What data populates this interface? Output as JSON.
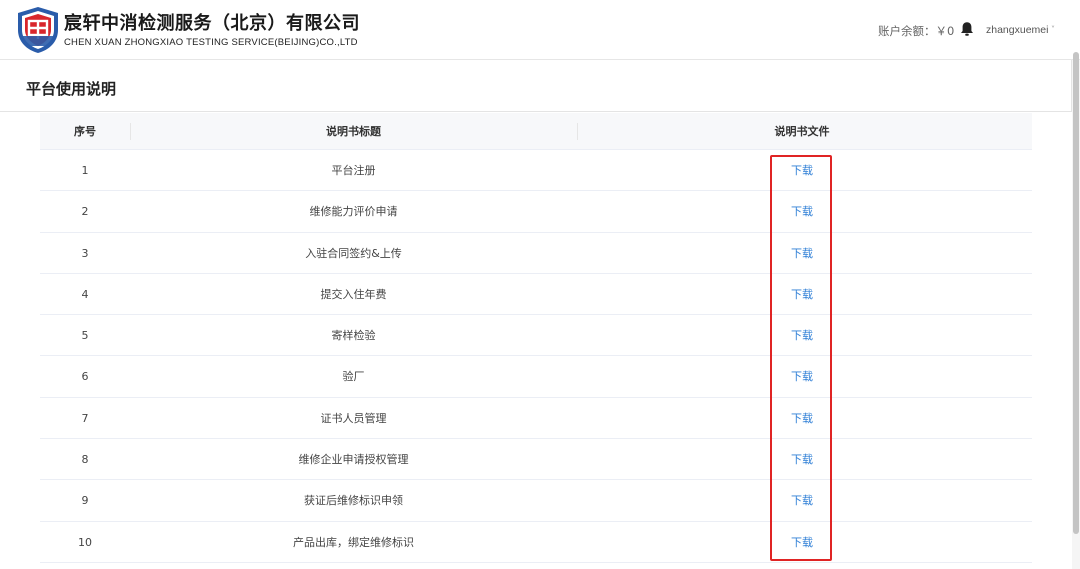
{
  "header": {
    "company_name_cn": "宸轩中消检测服务（北京）有限公司",
    "company_name_en": "CHEN XUAN ZHONGXIAO TESTING SERVICE(BEIJING)CO.,LTD",
    "balance_label": "账户余额：￥0",
    "username": "zhangxuemei",
    "user_caret": "˅",
    "logo_icon": "shield-logo-icon",
    "bell_icon": "bell-icon"
  },
  "page": {
    "title": "平台使用说明"
  },
  "table": {
    "columns": [
      "序号",
      "说明书标题",
      "说明书文件"
    ],
    "rows": [
      {
        "index": "1",
        "title": "平台注册",
        "file": "下载"
      },
      {
        "index": "2",
        "title": "维修能力评价申请",
        "file": "下载"
      },
      {
        "index": "3",
        "title": "入驻合同签约&上传",
        "file": "下载"
      },
      {
        "index": "4",
        "title": "提交入住年费",
        "file": "下载"
      },
      {
        "index": "5",
        "title": "寄样检验",
        "file": "下载"
      },
      {
        "index": "6",
        "title": "验厂",
        "file": "下载"
      },
      {
        "index": "7",
        "title": "证书人员管理",
        "file": "下载"
      },
      {
        "index": "8",
        "title": "维修企业申请授权管理",
        "file": "下载"
      },
      {
        "index": "9",
        "title": "获证后维修标识申领",
        "file": "下载"
      },
      {
        "index": "10",
        "title": "产品出库，绑定维修标识",
        "file": "下载"
      }
    ]
  },
  "colors": {
    "link": "#2f7fd6",
    "highlight_border": "#e02424",
    "logo_blue": "#2a5caa",
    "logo_red": "#d8262c"
  }
}
